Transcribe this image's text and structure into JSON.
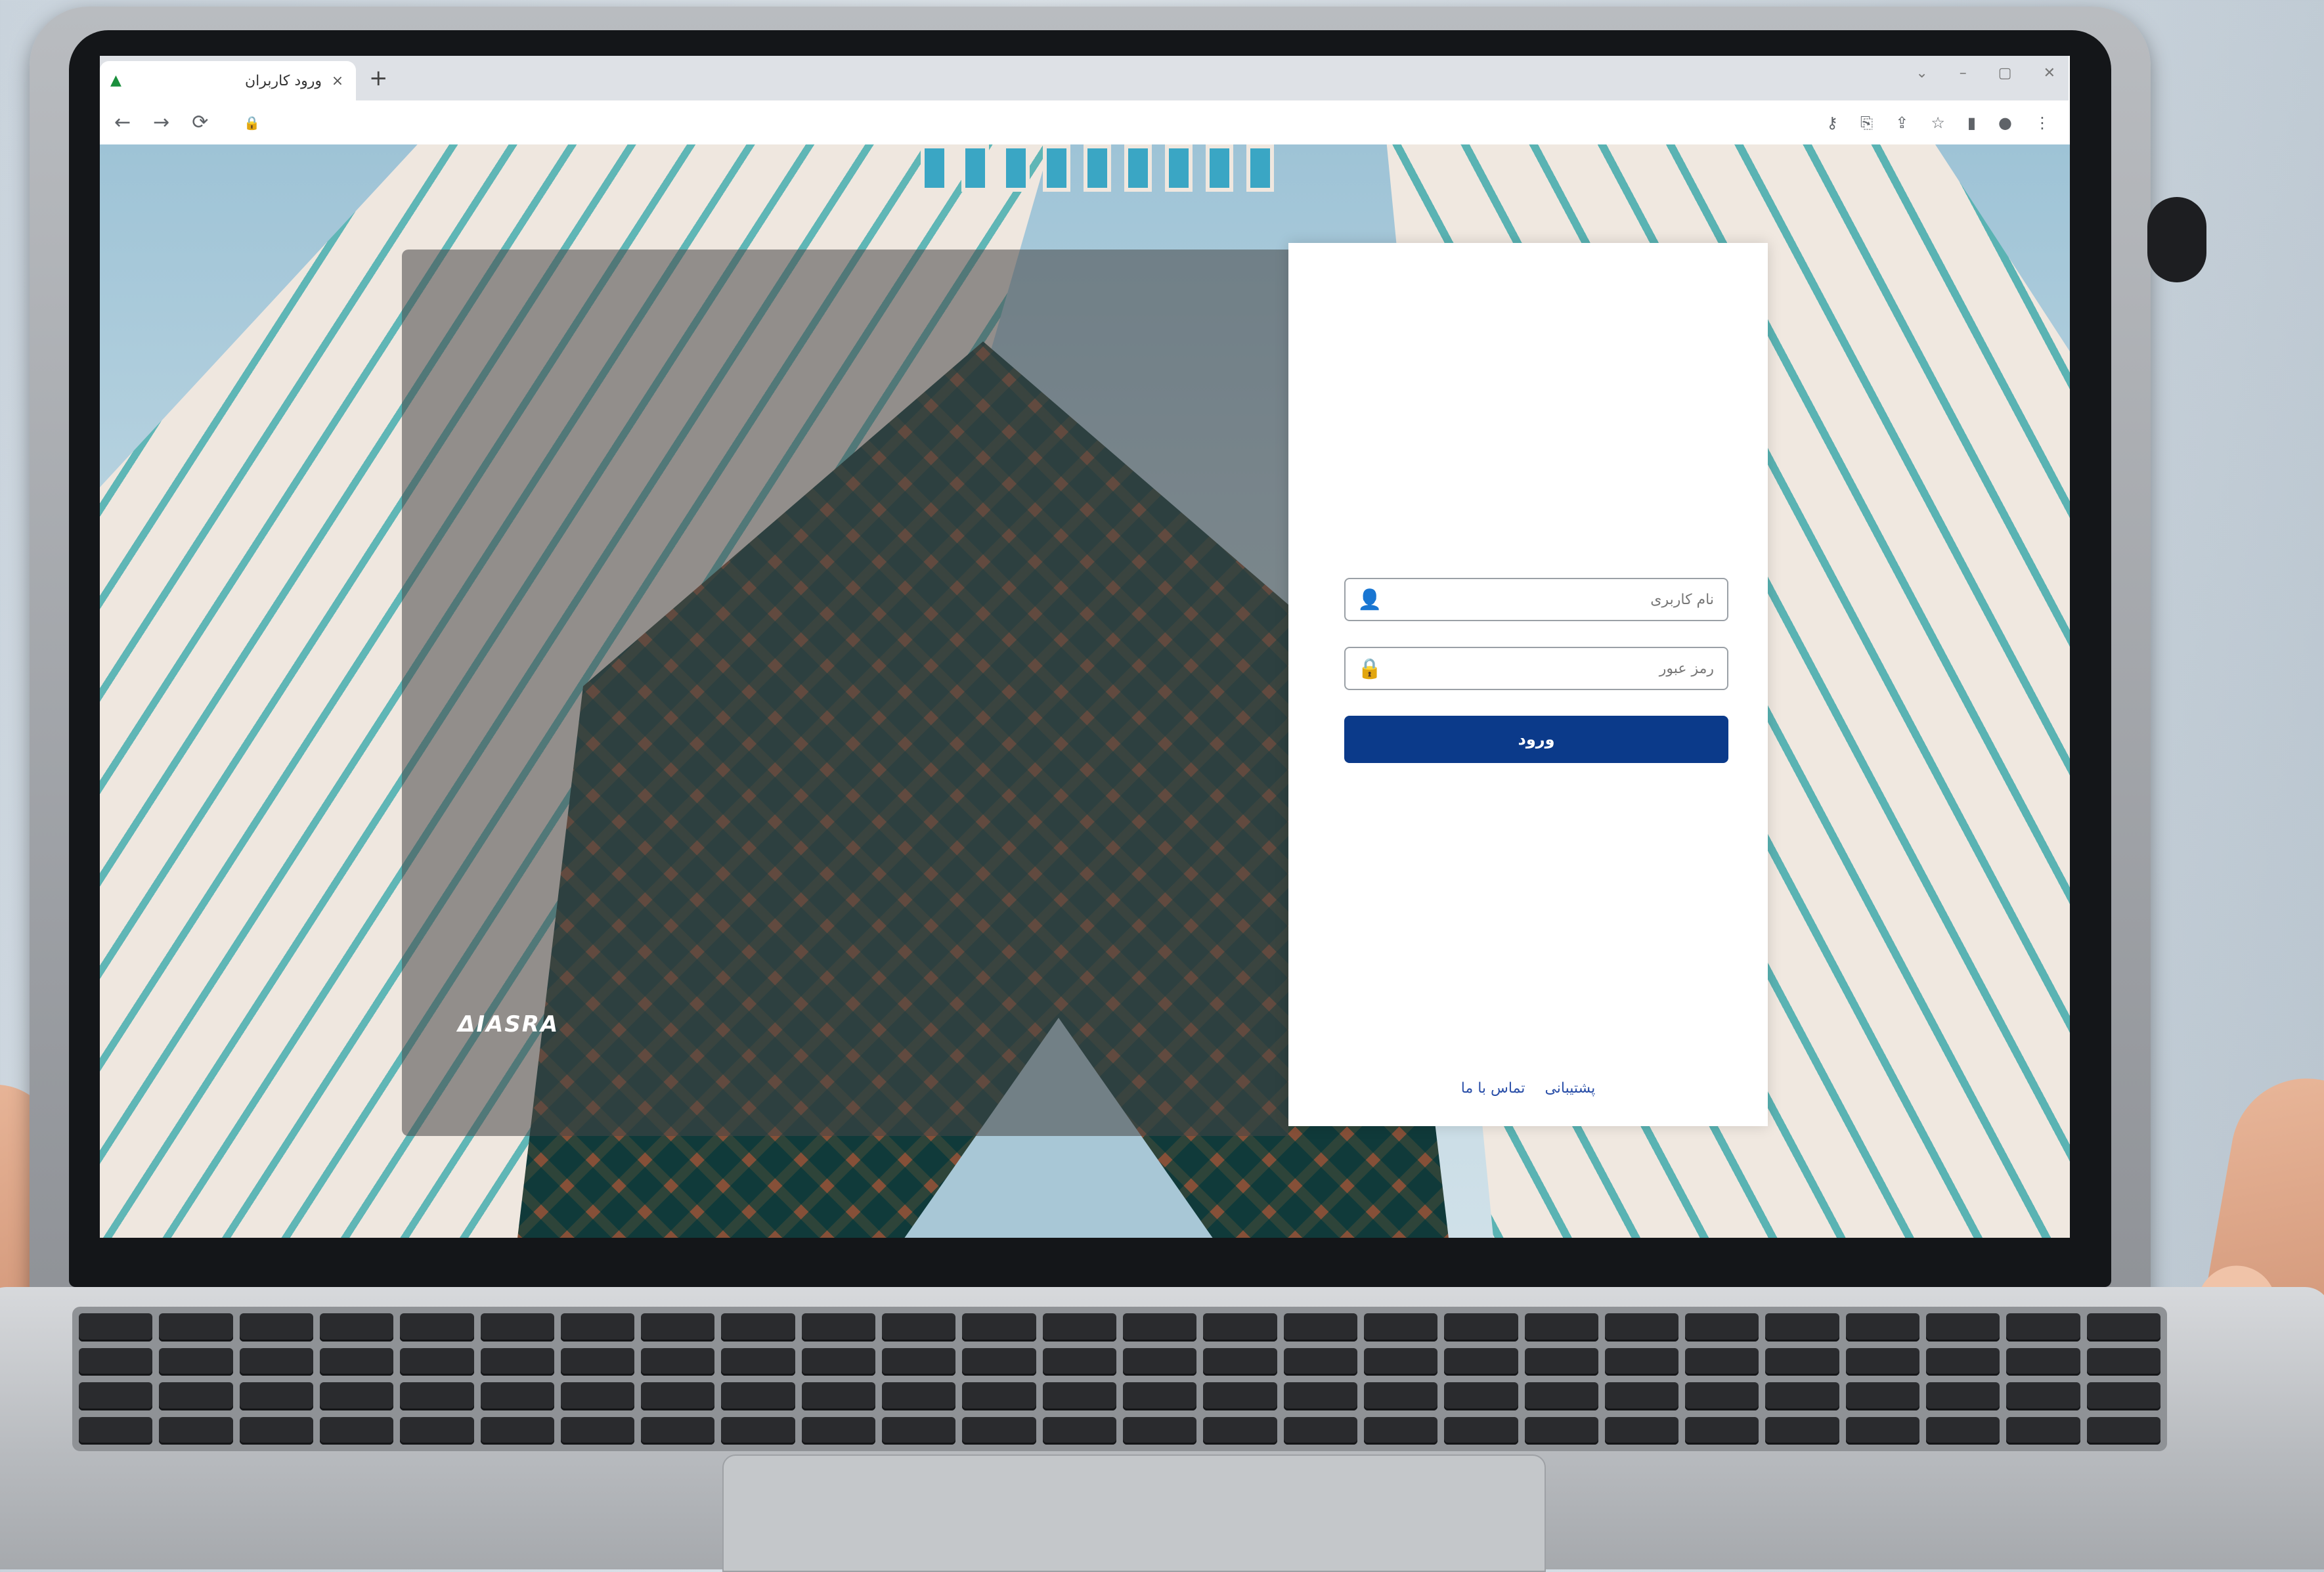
{
  "browser": {
    "tab_title": "ورود کاربران",
    "tab_icon": "app-logo-icon",
    "new_tab": "+",
    "tab_close": "×",
    "window_controls": [
      "⌄",
      "–",
      "▢",
      "✕"
    ],
    "nav": {
      "back": "←",
      "forward": "→",
      "reload": "⟳"
    },
    "lock": "🔒",
    "toolbar_icons": [
      "key-icon",
      "translate-icon",
      "share-icon",
      "star-icon",
      "sidebar-icon",
      "profile-icon",
      "menu-icon"
    ]
  },
  "login": {
    "username_placeholder": "نام کاربری",
    "password_placeholder": "رمز عبور",
    "submit_label": "ورود",
    "links": {
      "support": "پشتیبانی",
      "contact": "تماس با ما"
    }
  },
  "brand": {
    "logo_text": "ΔIASRA"
  },
  "colors": {
    "primary_button": "#0b3a8a",
    "link": "#2a4fa8"
  }
}
